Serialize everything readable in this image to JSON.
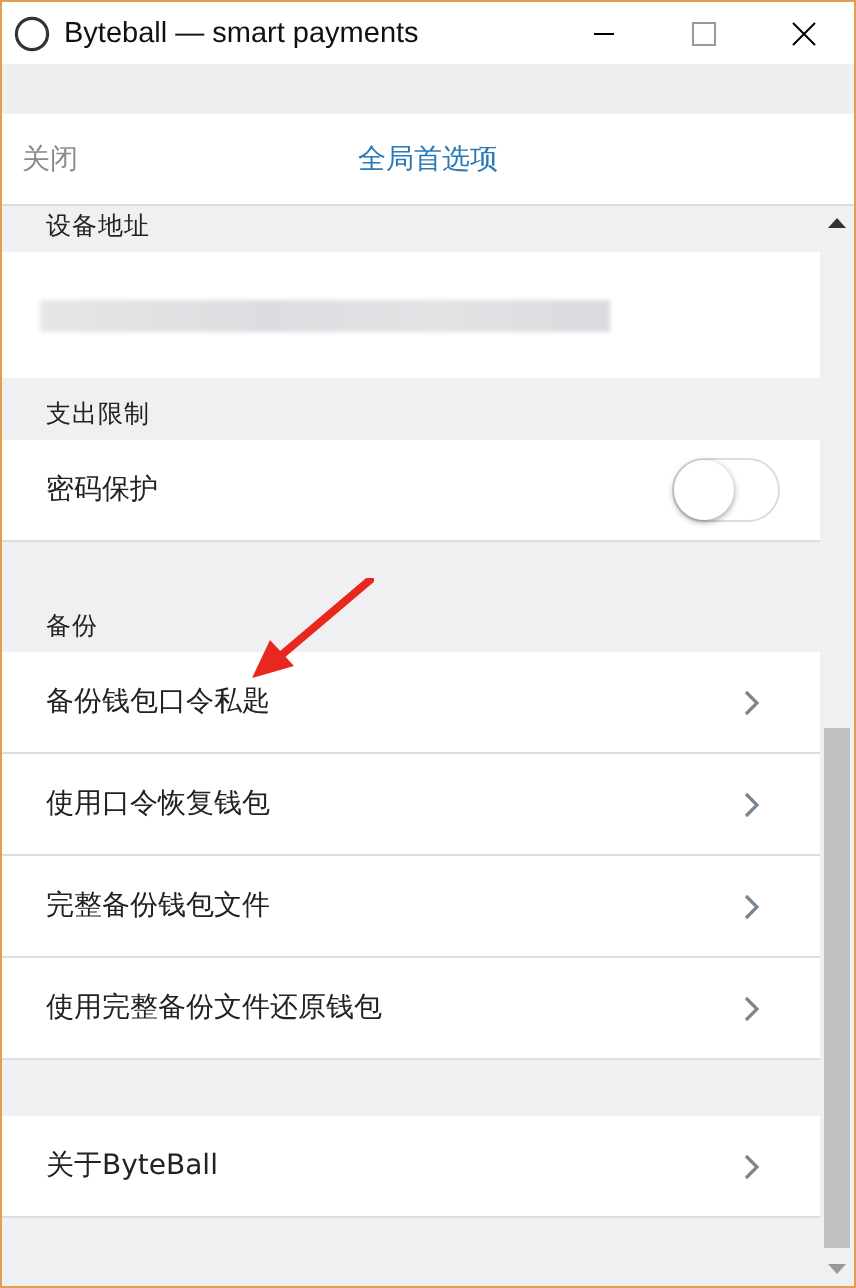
{
  "window": {
    "title": "Byteball — smart payments"
  },
  "header": {
    "close_link": "关闭",
    "title": "全局首选项"
  },
  "sections": [
    {
      "label": "设备地址",
      "kind": "address"
    },
    {
      "label": "支出限制",
      "kind": "list",
      "rows": [
        {
          "kind": "toggle",
          "label": "密码保护",
          "on": false
        }
      ]
    },
    {
      "label": "备份",
      "kind": "list",
      "rows": [
        {
          "kind": "link",
          "label": "备份钱包口令私匙"
        },
        {
          "kind": "link",
          "label": "使用口令恢复钱包"
        },
        {
          "kind": "link",
          "label": "完整备份钱包文件"
        },
        {
          "kind": "link",
          "label": "使用完整备份文件还原钱包"
        }
      ]
    },
    {
      "kind": "list",
      "rows": [
        {
          "kind": "link",
          "label": "关于ByteBall"
        }
      ]
    }
  ]
}
